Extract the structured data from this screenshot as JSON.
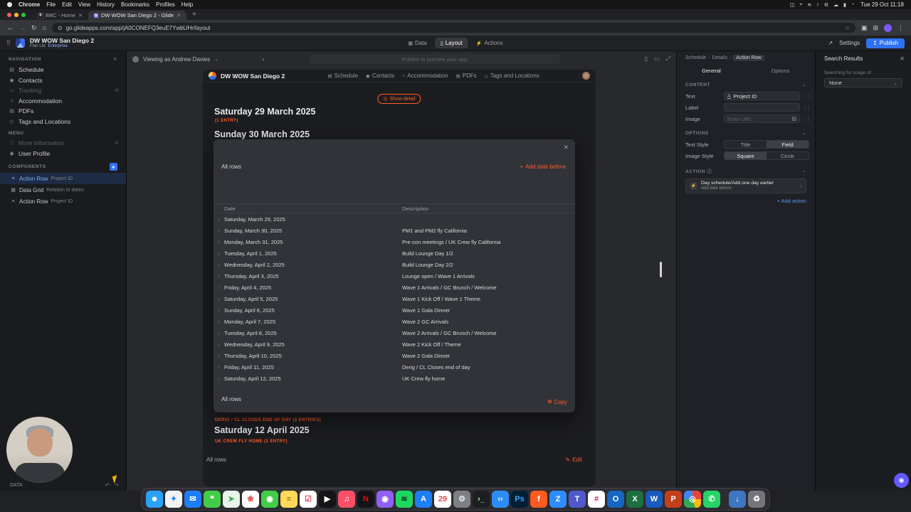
{
  "icons": {
    "back": "←",
    "forward": "→",
    "reload": "↻",
    "home": "⌂",
    "tune": "⊙",
    "star": "☆",
    "side_panel": "▣",
    "extensions": "⊞",
    "kebab": "⋮",
    "close": "✕",
    "new_tab": "+",
    "apps_grid": "⠿",
    "data": "▦",
    "layout": "▯",
    "actions": "⚡",
    "share": "↗",
    "publish": "↥",
    "chev_down": "⌄",
    "chev_right": "›",
    "chev_left": "‹",
    "plus": "+",
    "eye_off": "⊘",
    "schedule": "▤",
    "contacts": "◉",
    "trucking": "▭",
    "accommodation": "⌂",
    "pdfs": "▤",
    "tags": "◇",
    "info": "ⓘ",
    "user": "◉",
    "action_row": "≡",
    "data_grid": "▦",
    "undo": "↶",
    "redo": "↷",
    "device": "▯",
    "desktop": "▭",
    "fullscreen": "⤢",
    "show_detail": "◎",
    "copy": "⧉",
    "edit": "✎",
    "drag": "⋮⋮",
    "text_format": "A",
    "image": "▨",
    "lightning": "⚡",
    "profile": "◉"
  },
  "menubar": {
    "app": "Chrome",
    "items": [
      "File",
      "Edit",
      "View",
      "History",
      "Bookmarks",
      "Profiles",
      "Help"
    ],
    "status_icons": [
      "◫",
      "⌖",
      "≋",
      "♪",
      "⚙",
      "☁",
      "▮",
      "◔"
    ],
    "clock": "Tue 29 Oct 11:18"
  },
  "browser": {
    "tabs": [
      {
        "title": "BBC - Home",
        "fav": "B"
      },
      {
        "title": "DW WOW San Diego 2 - Glide",
        "fav": "G"
      }
    ],
    "url": "go.glideapps.com/app/jA0CONEFQ3euE7YwbUHr/layout"
  },
  "glide": {
    "title": "DW WOW San Diego 2",
    "org": "Flair Ltd",
    "plan": "Enterprise",
    "nav_tabs": [
      {
        "label": "Data"
      },
      {
        "label": "Layout"
      },
      {
        "label": "Actions"
      }
    ],
    "settings_label": "Settings",
    "publish_label": "Publish",
    "sidebar": {
      "nav_title": "NAVIGATION",
      "nav_items": [
        {
          "label": "Schedule"
        },
        {
          "label": "Contacts"
        },
        {
          "label": "Trucking"
        },
        {
          "label": "Accommodation"
        },
        {
          "label": "PDFs"
        },
        {
          "label": "Tags and Locations"
        }
      ],
      "menu_title": "MENU",
      "menu_items": [
        {
          "label": "More Information"
        },
        {
          "label": "User Profile"
        }
      ],
      "components_title": "COMPONENTS",
      "components": [
        {
          "type": "Action Row",
          "field": "Project ID"
        },
        {
          "type": "Data Grid",
          "field": "Relation to dates"
        },
        {
          "type": "Action Row",
          "field": "Project ID"
        }
      ],
      "data_label": "DATA"
    },
    "preview": {
      "viewing_as": "Viewing as Andrew Davies",
      "publish_hint": "Publish to preview your app",
      "app": {
        "title": "DW WOW San Diego 2",
        "tabs": [
          {
            "label": "Schedule",
            "g": "▤"
          },
          {
            "label": "Contacts",
            "g": "◉"
          },
          {
            "label": "Accommodation",
            "g": "⌂"
          },
          {
            "label": "PDFs",
            "g": "▤"
          },
          {
            "label": "Tags and Locations",
            "g": "◇"
          }
        ],
        "show_detail": "Show detail",
        "date1": "Saturday 29 March 2025",
        "date1_meta": "(1 ENTRY)",
        "date2": "Sunday 30 March 2025",
        "date3_meta": "DERIG / CL CLOSES END OF DAY (2 ENTRIES)",
        "date3": "Saturday 12 April 2025",
        "date4_meta": "UK CREW FLY HOME (1 ENTRY)",
        "grid_label": "All rows",
        "edit_label": "Edit"
      },
      "modal": {
        "title": "All rows",
        "add_before": "Add date before",
        "col_date": "Date",
        "col_desc": "Description",
        "rows": [
          {
            "date": "Saturday, March 29, 2025",
            "desc": ""
          },
          {
            "date": "Sunday, March 30, 2025",
            "desc": "PM1 and PM2 fly California"
          },
          {
            "date": "Monday, March 31, 2025",
            "desc": "Pre-con meetings / UK Crew fly California"
          },
          {
            "date": "Tuesday, April 1, 2025",
            "desc": "Build Lounge Day 1/2"
          },
          {
            "date": "Wednesday, April 2, 2025",
            "desc": "Build Lounge Day 2/2"
          },
          {
            "date": "Thursday, April 3, 2025",
            "desc": "Lounge open / Wave 1 Arrivals"
          },
          {
            "date": "Friday, April 4, 2025",
            "desc": "Wave 1 Arrivals / GC Brunch / Welcome"
          },
          {
            "date": "Saturday, April 5, 2025",
            "desc": "Wave 1 Kick Off / Wave 1 Theme"
          },
          {
            "date": "Sunday, April 6, 2025",
            "desc": "Wave 1 Gala Dinner"
          },
          {
            "date": "Monday, April 7, 2025",
            "desc": "Wave 2 GC Arrivals"
          },
          {
            "date": "Tuesday, April 8, 2025",
            "desc": "Wave 2 Arrivals / GC Brunch / Welcome"
          },
          {
            "date": "Wednesday, April 9, 2025",
            "desc": "Wave 2 Kick Off / Theme"
          },
          {
            "date": "Thursday, April 10, 2025",
            "desc": "Wave 2 Gala Dinner"
          },
          {
            "date": "Friday, April 11, 2025",
            "desc": "Derig / CL Closes end of day"
          },
          {
            "date": "Saturday, April 12, 2025",
            "desc": "UK Crew fly home"
          }
        ],
        "footer_label": "All rows",
        "copy_label": "Copy"
      }
    },
    "inspector": {
      "breadcrumb": [
        "Schedule",
        "Details",
        "Action Row"
      ],
      "tabs": [
        {
          "label": "General"
        },
        {
          "label": "Options"
        }
      ],
      "content_title": "CONTENT",
      "fields": [
        {
          "label": "Text",
          "value": "Project ID"
        },
        {
          "label": "Label",
          "value": ""
        },
        {
          "label": "Image",
          "placeholder": "Enter URL"
        }
      ],
      "options_title": "OPTIONS",
      "text_style": {
        "label": "Text Style",
        "options": [
          "Title",
          "Field"
        ],
        "selected": "Field"
      },
      "image_style": {
        "label": "Image Style",
        "options": [
          "Square",
          "Circle"
        ],
        "selected": "Square"
      },
      "action_title": "ACTION",
      "action": {
        "title": "Day schedule/Add one day earlier",
        "subtitle": "Add date before"
      },
      "add_action": "+ Add action"
    },
    "search_panel": {
      "title": "Search Results",
      "hint": "Searching for usage of:",
      "value": "None"
    }
  },
  "dock": {
    "items": [
      {
        "name": "finder",
        "g": "☻",
        "bg": "#2aa2f7",
        "fg": "#ffffff"
      },
      {
        "name": "safari",
        "g": "✦",
        "bg": "#f2f3f5",
        "fg": "#1e7ef7"
      },
      {
        "name": "mail",
        "g": "✉",
        "bg": "#1e7ef7",
        "fg": "#ffffff"
      },
      {
        "name": "messages",
        "g": "❝",
        "bg": "#43cc47",
        "fg": "#ffffff"
      },
      {
        "name": "maps",
        "g": "➤",
        "bg": "#e8f3ea",
        "fg": "#34a853"
      },
      {
        "name": "photos",
        "g": "❀",
        "bg": "#ffffff",
        "fg": "#e6484f"
      },
      {
        "name": "facetime",
        "g": "◉",
        "bg": "#43cc47",
        "fg": "#ffffff"
      },
      {
        "name": "notes",
        "g": "≡",
        "bg": "#ffd957",
        "fg": "#8a6d1a"
      },
      {
        "name": "reminders",
        "g": "☑",
        "bg": "#ffffff",
        "fg": "#e6484f"
      },
      {
        "name": "apple-tv",
        "g": "▶",
        "bg": "#141416",
        "fg": "#ffffff"
      },
      {
        "name": "music",
        "g": "♫",
        "bg": "#fd4f67",
        "fg": "#ffffff"
      },
      {
        "name": "netflix",
        "g": "N",
        "bg": "#141416",
        "fg": "#e50914"
      },
      {
        "name": "podcasts",
        "g": "◉",
        "bg": "#9160f2",
        "fg": "#ffffff"
      },
      {
        "name": "spotify",
        "g": "≋",
        "bg": "#1ed760",
        "fg": "#0a3d1e"
      },
      {
        "name": "app-store",
        "g": "A",
        "bg": "#1e7ef7",
        "fg": "#ffffff"
      },
      {
        "name": "calendar",
        "g": "29",
        "bg": "#ffffff",
        "fg": "#e6484f"
      },
      {
        "name": "system-settings",
        "g": "⚙",
        "bg": "#7d8086",
        "fg": "#e9e9ec"
      },
      {
        "name": "terminal",
        "g": "›_",
        "bg": "#1d1e22",
        "fg": "#9ef59e"
      },
      {
        "name": "vscode",
        "g": "‹›",
        "bg": "#2c8cf4",
        "fg": "#ffffff"
      },
      {
        "name": "photoshop",
        "g": "Ps",
        "bg": "#001e36",
        "fg": "#31a8ff"
      },
      {
        "name": "flair",
        "g": "f",
        "bg": "#ff5a1f",
        "fg": "#ffffff"
      },
      {
        "name": "zoom",
        "g": "Z",
        "bg": "#2d8cff",
        "fg": "#ffffff"
      },
      {
        "name": "teams",
        "g": "T",
        "bg": "#5059c9",
        "fg": "#ffffff"
      },
      {
        "name": "slack",
        "g": "#",
        "bg": "#ffffff",
        "fg": "#e01e5a"
      },
      {
        "name": "outlook",
        "g": "O",
        "bg": "#1466c0",
        "fg": "#ffffff"
      },
      {
        "name": "excel",
        "g": "X",
        "bg": "#1d6f42",
        "fg": "#ffffff"
      },
      {
        "name": "word",
        "g": "W",
        "bg": "#185abd",
        "fg": "#ffffff"
      },
      {
        "name": "powerpoint",
        "g": "P",
        "bg": "#c43e1c",
        "fg": "#ffffff"
      },
      {
        "name": "chrome",
        "g": "◎",
        "bg": "conic-gradient(#ea4335 0 25%, #fbbc05 25% 45%, #34a853 45% 75%, #4285f4 75% 100%)",
        "fg": "#ffffff"
      },
      {
        "name": "whatsapp",
        "g": "✆",
        "bg": "#25d366",
        "fg": "#ffffff"
      },
      {
        "name": "downloads-folder",
        "g": "↓",
        "bg": "#3f76c0",
        "fg": "#ffffff"
      },
      {
        "name": "trash",
        "g": "♻",
        "bg": "#74767c",
        "fg": "#ffffff"
      }
    ]
  }
}
